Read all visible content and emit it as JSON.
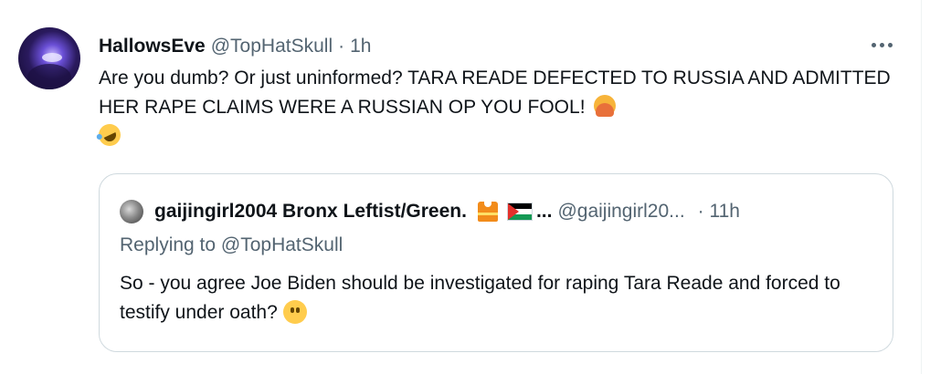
{
  "tweet": {
    "display_name": "HallowsEve",
    "handle": "@TopHatSkull",
    "separator": "·",
    "time": "1h",
    "text": "Are you dumb? Or just uninformed? TARA READE DEFECTED TO RUSSIA AND ADMITTED HER RAPE CLAIMS WERE A RUSSIAN OP YOU FOOL!",
    "emojis": [
      "facepalm-emoji",
      "rofl-emoji"
    ]
  },
  "quote": {
    "display_name": "gaijingirl2004 Bronx Leftist/Green.",
    "name_icons": [
      "safety-vest-icon",
      "palestine-flag-icon"
    ],
    "ellipsis": "...",
    "handle": "@gaijingirl20...",
    "time": "· 11h",
    "replying_prefix": "Replying to",
    "replying_handle": "@TopHatSkull",
    "text": "So - you agree Joe Biden should be investigated for raping Tara Reade and forced to testify under oath?",
    "emoji": "face-without-mouth-emoji"
  },
  "colors": {
    "text_primary": "#0f1419",
    "text_secondary": "#536471",
    "border": "#cfd9de"
  }
}
